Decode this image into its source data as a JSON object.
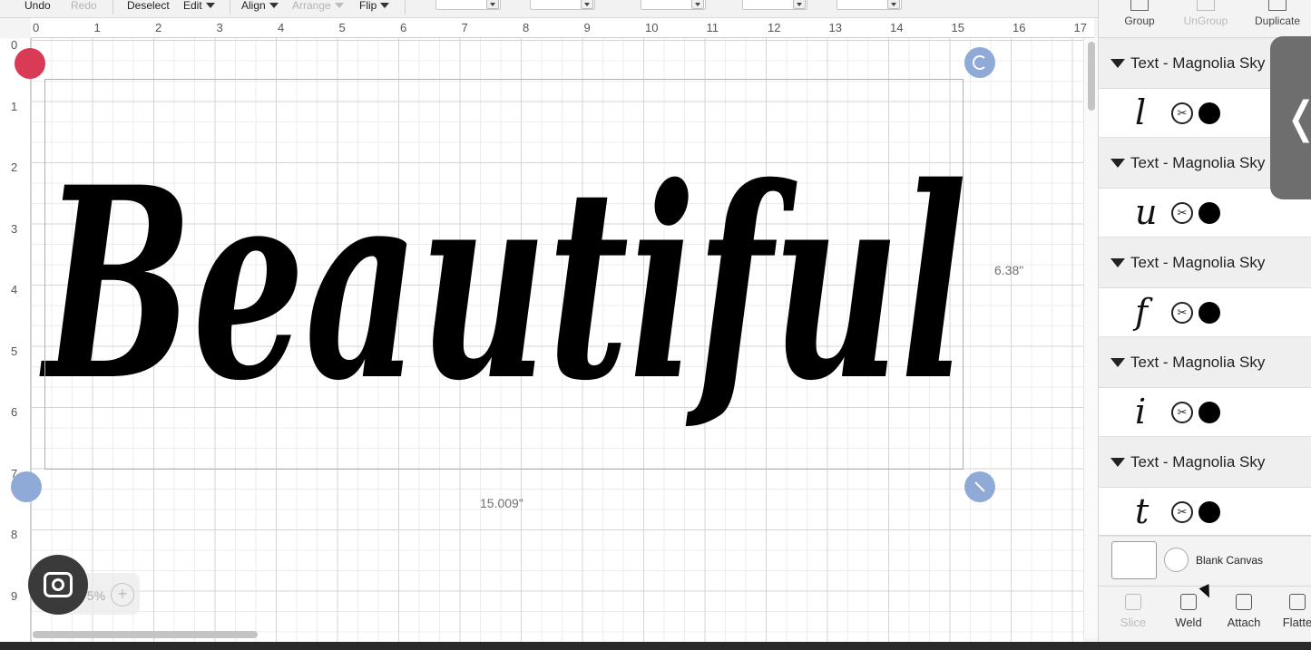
{
  "toolbar": {
    "undo": "Undo",
    "redo": "Redo",
    "deselect": "Deselect",
    "edit": "Edit",
    "align": "Align",
    "arrange": "Arrange",
    "flip": "Flip"
  },
  "ruler": {
    "top": [
      "0",
      "1",
      "2",
      "3",
      "4",
      "5",
      "6",
      "7",
      "8",
      "9",
      "10",
      "11",
      "12",
      "13",
      "14",
      "15",
      "16",
      "17"
    ],
    "left": [
      "0",
      "1",
      "2",
      "3",
      "4",
      "5",
      "6",
      "7",
      "8",
      "9"
    ]
  },
  "canvas": {
    "design_text": "Beautiful",
    "design_color": "#000000",
    "width_label": "15.009\"",
    "height_label": "6.38\""
  },
  "zoom": {
    "value": "75%",
    "plus": "+"
  },
  "panel": {
    "tools": {
      "group": "Group",
      "ungroup": "UnGroup",
      "duplicate": "Duplicate"
    },
    "layers": [
      {
        "name": "Text - Magnolia Sky",
        "glyph": "l"
      },
      {
        "name": "Text - Magnolia Sky",
        "glyph": "u"
      },
      {
        "name": "Text - Magnolia Sky",
        "glyph": "f"
      },
      {
        "name": "Text - Magnolia Sky",
        "glyph": "i"
      },
      {
        "name": "Text - Magnolia Sky",
        "glyph": "t"
      }
    ],
    "cut_icon_text": "✂",
    "blank_canvas": "Blank Canvas",
    "bottom_tools": {
      "slice": "Slice",
      "weld": "Weld",
      "attach": "Attach",
      "flatten": "Flatte"
    },
    "collapse_glyph": "❬"
  },
  "colors": {
    "selection": "#9cb4d6",
    "delete_handle": "#d93a55",
    "handle": "#8faad6"
  }
}
